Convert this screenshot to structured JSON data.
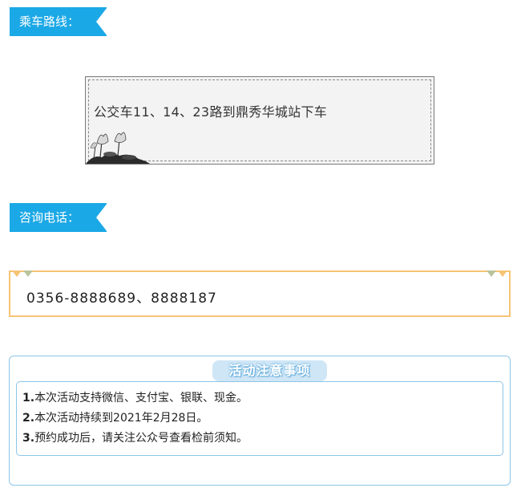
{
  "route": {
    "tag_label": "乘车路线：",
    "text": "公交车11、14、23路到鼎秀华城站下车"
  },
  "phone": {
    "tag_label": "咨询电话：",
    "text": "0356-8888689、8888187"
  },
  "notice": {
    "title": "活动注意事项",
    "items": [
      {
        "num": "1.",
        "text": "本次活动支持微信、支付宝、银联、现金。"
      },
      {
        "num": "2.",
        "text": "本次活动持续到2021年2月28日。"
      },
      {
        "num": "3.",
        "text": "预约成功后，请关注公众号查看检前须知。"
      }
    ]
  },
  "colors": {
    "tag_blue": "#1ba8e6",
    "phone_border": "#f6c375",
    "notice_border": "#8cc6e6"
  }
}
